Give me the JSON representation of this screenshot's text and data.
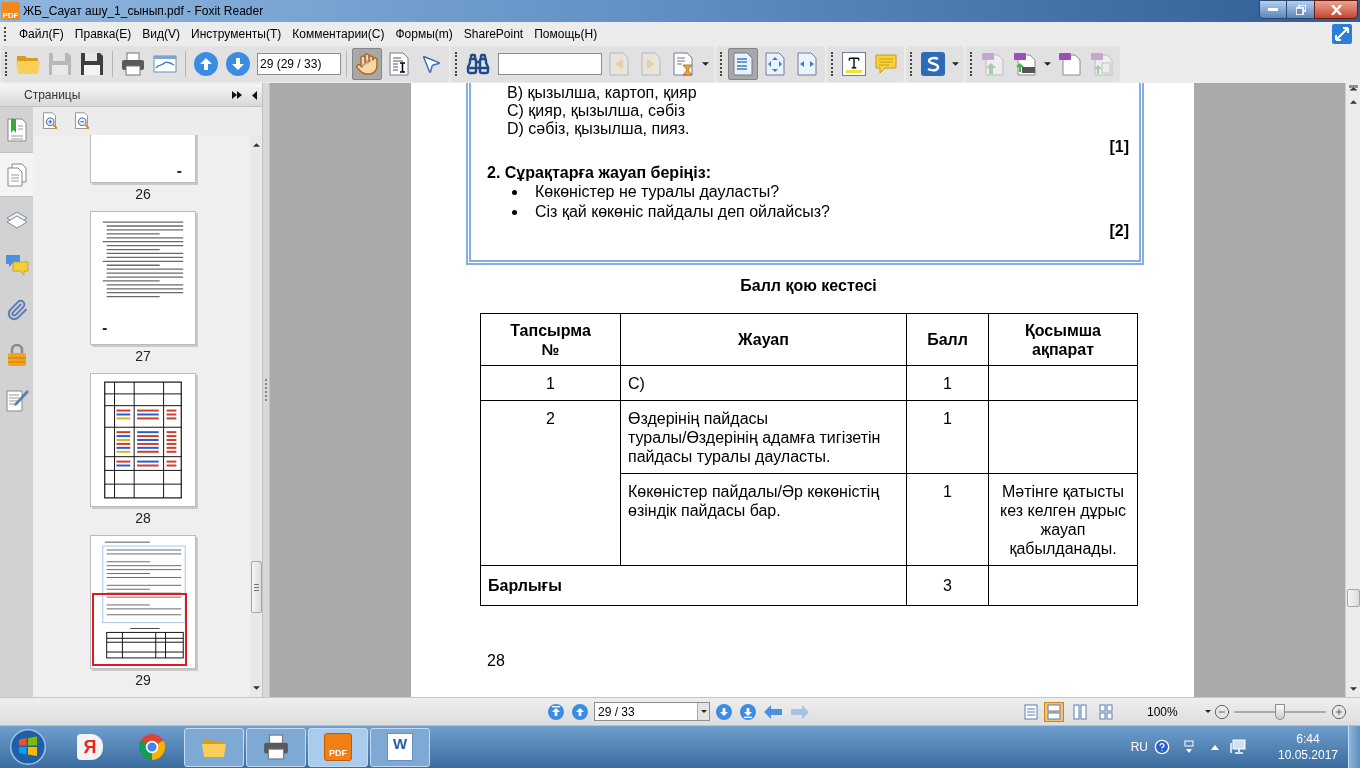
{
  "window": {
    "icon_text": "PDF",
    "title": "ЖБ_Сауат ашу_1_сынып.pdf - Foxit Reader"
  },
  "menu": [
    "Файл(F)",
    "Правка(E)",
    "Вид(V)",
    "Инструменты(T)",
    "Комментарии(C)",
    "Формы(m)",
    "SharePoint",
    "Помощь(H)"
  ],
  "toolbar": {
    "file_buttons": [
      {
        "disabled": false
      },
      {
        "disabled": true
      },
      {
        "disabled": false
      },
      {
        "disabled": false
      },
      {
        "disabled": false
      }
    ],
    "page_field": {
      "value": "29 (29 / 33)"
    },
    "tools": [
      {
        "selected": true
      },
      {
        "selected": false
      },
      {
        "selected": false
      }
    ],
    "find_buttons": [
      {
        "disabled": true
      },
      {
        "disabled": true
      }
    ],
    "zoom_buttons": [
      {
        "selected": true
      },
      {
        "selected": false
      },
      {
        "selected": false
      }
    ],
    "pdf_buttons": [
      {
        "disabled": true
      },
      {
        "disabled": false
      },
      {
        "disabled": false
      },
      {
        "disabled": true
      }
    ]
  },
  "sidebar": {
    "title": "Страницы",
    "tabs": [
      {
        "selected": false
      },
      {
        "selected": true
      },
      {
        "selected": false
      },
      {
        "selected": false
      },
      {
        "selected": false
      },
      {
        "selected": false
      },
      {
        "selected": false
      }
    ],
    "thumbnails": [
      {
        "label": "26",
        "kind": "blank",
        "selected": false
      },
      {
        "label": "27",
        "kind": "text",
        "selected": false
      },
      {
        "label": "28",
        "kind": "table",
        "selected": false
      },
      {
        "label": "29",
        "kind": "mixed",
        "selected": true
      }
    ]
  },
  "document": {
    "options": [
      "B) қызылша, картоп, қияр",
      "C) қияр, қызылша, сәбіз",
      "D) сәбіз, қызылша, пияз."
    ],
    "mark_1": "[1]",
    "question": "2. Сұрақтарға жауап беріңіз:",
    "bullets": [
      "Көкөністер не туралы дауласты?",
      "Сіз қай көкөніс пайдалы деп ойлайсыз?"
    ],
    "mark_2": "[2]",
    "table_title": "Балл қою кестесі",
    "table": {
      "columns": [
        "Тапсырма №",
        "Жауап",
        "Балл",
        "Қосымша ақпарат"
      ],
      "rows": [
        {
          "task": "1",
          "answers": [
            {
              "answer": "C)",
              "score": "1"
            }
          ]
        },
        {
          "task": "2",
          "answers": [
            {
              "answer": "Өздерінің пайдасы туралы/Өздерінің адамға тигізетін пайдасы туралы дауласты.",
              "score": "1"
            },
            {
              "answer": "Көкөністер пайдалы/Әр көкөністің өзіндік пайдасы бар.",
              "score": "1",
              "info": "Мәтінге қатысты кез келген дұрыс жауап қабылданады."
            }
          ]
        }
      ],
      "total": {
        "label": "Барлығы",
        "score": "3"
      }
    },
    "page_number": "28"
  },
  "status_bar": {
    "page_field": {
      "value": "29 / 33"
    },
    "history": [
      {
        "disabled": false
      },
      {
        "disabled": true
      }
    ],
    "view_modes": [
      {
        "selected": false
      },
      {
        "selected": true
      },
      {
        "selected": false
      },
      {
        "selected": false
      }
    ],
    "zoom": "100%",
    "zoom_slider": {
      "level": 0.5
    }
  },
  "taskbar": {
    "apps": [
      {
        "text": "Я",
        "running": false,
        "selected": false
      },
      {
        "running": false,
        "selected": false
      },
      {
        "running": true,
        "selected": false
      },
      {
        "running": true,
        "selected": false
      },
      {
        "text": "PDF",
        "running": true,
        "selected": true
      },
      {
        "text": "W",
        "running": true,
        "selected": false
      }
    ],
    "tray": {
      "language": "RU",
      "time": "6:44",
      "date": "10.05.2017"
    }
  }
}
